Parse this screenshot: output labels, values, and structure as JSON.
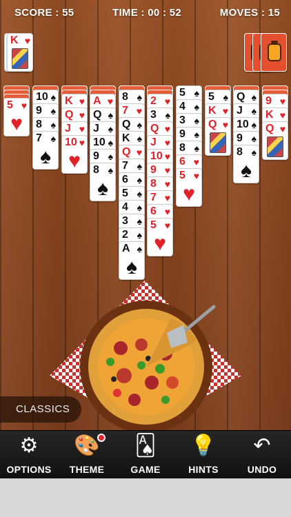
{
  "hud": {
    "score": "SCORE : 55",
    "time": "TIME : 00 : 52",
    "moves": "MOVES : 15"
  },
  "foundation": {
    "rank": "K",
    "suit": "♥",
    "stack_label": "KK"
  },
  "stock": {
    "piles_remaining": 3
  },
  "mode_label": "CLASSICS",
  "toolbar": {
    "options": "OPTIONS",
    "theme": "THEME",
    "game": "GAME",
    "hints": "HINTS",
    "undo": "UNDO"
  },
  "icons": {
    "options": "gear-icon",
    "theme": "palette-icon",
    "game": "cards-icon",
    "hints": "lightbulb-icon",
    "undo": "undo-arrow-icon"
  },
  "colors": {
    "red_suit": "#e0212a",
    "black_suit": "#111111",
    "card_back": "#e4502e",
    "toolbar": "#1c1c1c",
    "notification": "#e3222e"
  },
  "columns": [
    {
      "hidden": 3,
      "cards": [
        {
          "r": "5",
          "s": "♥",
          "c": "red"
        }
      ]
    },
    {
      "hidden": 1,
      "cards": [
        {
          "r": "10",
          "s": "♠",
          "c": "blk"
        },
        {
          "r": "9",
          "s": "♠",
          "c": "blk"
        },
        {
          "r": "8",
          "s": "♠",
          "c": "blk"
        },
        {
          "r": "7",
          "s": "♠",
          "c": "blk"
        }
      ]
    },
    {
      "hidden": 2,
      "cards": [
        {
          "r": "K",
          "s": "♥",
          "c": "red"
        },
        {
          "r": "Q",
          "s": "♥",
          "c": "red"
        },
        {
          "r": "J",
          "s": "♥",
          "c": "red"
        },
        {
          "r": "10",
          "s": "♥",
          "c": "red"
        }
      ]
    },
    {
      "hidden": 2,
      "cards": [
        {
          "r": "A",
          "s": "♥",
          "c": "red"
        },
        {
          "r": "Q",
          "s": "♠",
          "c": "blk"
        },
        {
          "r": "J",
          "s": "♠",
          "c": "blk"
        },
        {
          "r": "10",
          "s": "♠",
          "c": "blk"
        },
        {
          "r": "9",
          "s": "♠",
          "c": "blk"
        },
        {
          "r": "8",
          "s": "♠",
          "c": "blk"
        }
      ]
    },
    {
      "hidden": 1,
      "cards": [
        {
          "r": "8",
          "s": "♠",
          "c": "blk"
        },
        {
          "r": "7",
          "s": "♥",
          "c": "red"
        },
        {
          "r": "Q",
          "s": "♠",
          "c": "blk"
        },
        {
          "r": "K",
          "s": "♠",
          "c": "blk"
        },
        {
          "r": "Q",
          "s": "♥",
          "c": "red"
        },
        {
          "r": "7",
          "s": "♠",
          "c": "blk"
        },
        {
          "r": "6",
          "s": "♠",
          "c": "blk"
        },
        {
          "r": "5",
          "s": "♠",
          "c": "blk"
        },
        {
          "r": "4",
          "s": "♠",
          "c": "blk"
        },
        {
          "r": "3",
          "s": "♠",
          "c": "blk"
        },
        {
          "r": "2",
          "s": "♠",
          "c": "blk"
        },
        {
          "r": "A",
          "s": "♠",
          "c": "blk"
        }
      ]
    },
    {
      "hidden": 2,
      "cards": [
        {
          "r": "2",
          "s": "♥",
          "c": "red"
        },
        {
          "r": "3",
          "s": "♠",
          "c": "blk"
        },
        {
          "r": "Q",
          "s": "♥",
          "c": "red"
        },
        {
          "r": "J",
          "s": "♥",
          "c": "red"
        },
        {
          "r": "10",
          "s": "♥",
          "c": "red"
        },
        {
          "r": "9",
          "s": "♥",
          "c": "red"
        },
        {
          "r": "8",
          "s": "♥",
          "c": "red"
        },
        {
          "r": "7",
          "s": "♥",
          "c": "red"
        },
        {
          "r": "6",
          "s": "♥",
          "c": "red"
        },
        {
          "r": "5",
          "s": "♥",
          "c": "red"
        }
      ]
    },
    {
      "hidden": 0,
      "cards": [
        {
          "r": "5",
          "s": "♠",
          "c": "blk"
        },
        {
          "r": "4",
          "s": "♠",
          "c": "blk"
        },
        {
          "r": "3",
          "s": "♠",
          "c": "blk"
        },
        {
          "r": "9",
          "s": "♠",
          "c": "blk"
        },
        {
          "r": "8",
          "s": "♠",
          "c": "blk"
        },
        {
          "r": "6",
          "s": "♥",
          "c": "red"
        },
        {
          "r": "5",
          "s": "♥",
          "c": "red"
        }
      ]
    },
    {
      "hidden": 1,
      "cards": [
        {
          "r": "5",
          "s": "♠",
          "c": "blk"
        },
        {
          "r": "K",
          "s": "♥",
          "c": "red"
        },
        {
          "r": "Q",
          "s": "♥",
          "c": "red",
          "face": true
        }
      ]
    },
    {
      "hidden": 1,
      "cards": [
        {
          "r": "Q",
          "s": "♠",
          "c": "blk"
        },
        {
          "r": "J",
          "s": "♠",
          "c": "blk"
        },
        {
          "r": "10",
          "s": "♠",
          "c": "blk"
        },
        {
          "r": "9",
          "s": "♠",
          "c": "blk"
        },
        {
          "r": "8",
          "s": "♠",
          "c": "blk"
        }
      ]
    },
    {
      "hidden": 2,
      "cards": [
        {
          "r": "9",
          "s": "♥",
          "c": "red"
        },
        {
          "r": "K",
          "s": "♥",
          "c": "red"
        },
        {
          "r": "Q",
          "s": "♥",
          "c": "red",
          "face": true
        }
      ]
    }
  ]
}
